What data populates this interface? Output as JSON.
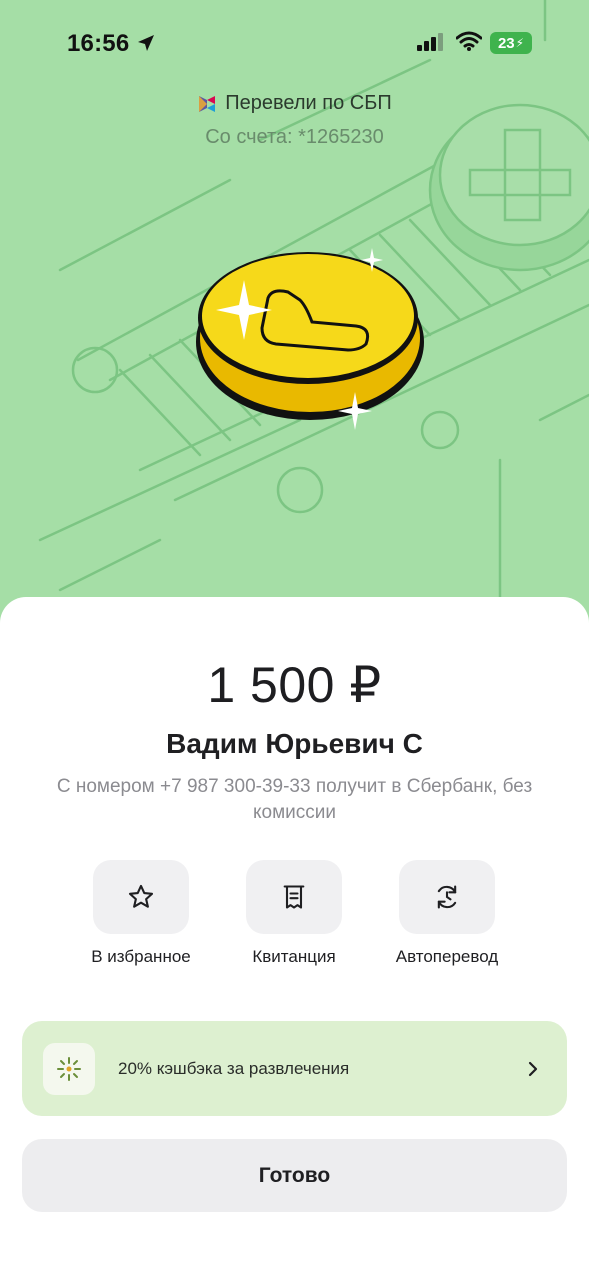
{
  "status_bar": {
    "time": "16:56",
    "battery": "23"
  },
  "header": {
    "transfer_status": "Перевели по СБП",
    "account": "Со счета: *1265230"
  },
  "transfer": {
    "amount": "1 500 ₽",
    "recipient": "Вадим Юрьевич С",
    "description": "С номером +7 987 300-39-33 получит в Сбербанк, без комиссии"
  },
  "actions": [
    {
      "label": "В избранное",
      "icon": "star-icon"
    },
    {
      "label": "Квитанция",
      "icon": "receipt-icon"
    },
    {
      "label": "Автоперевод",
      "icon": "auto-transfer-icon"
    }
  ],
  "promo": {
    "text": "20% кэшбэка за развлечения",
    "icon": "fireworks-icon"
  },
  "done_label": "Готово",
  "colors": {
    "hero_bg": "#a5dea6",
    "coin": "#f6d91a",
    "promo_bg": "#ddf0d0",
    "battery": "#3fb34d"
  }
}
